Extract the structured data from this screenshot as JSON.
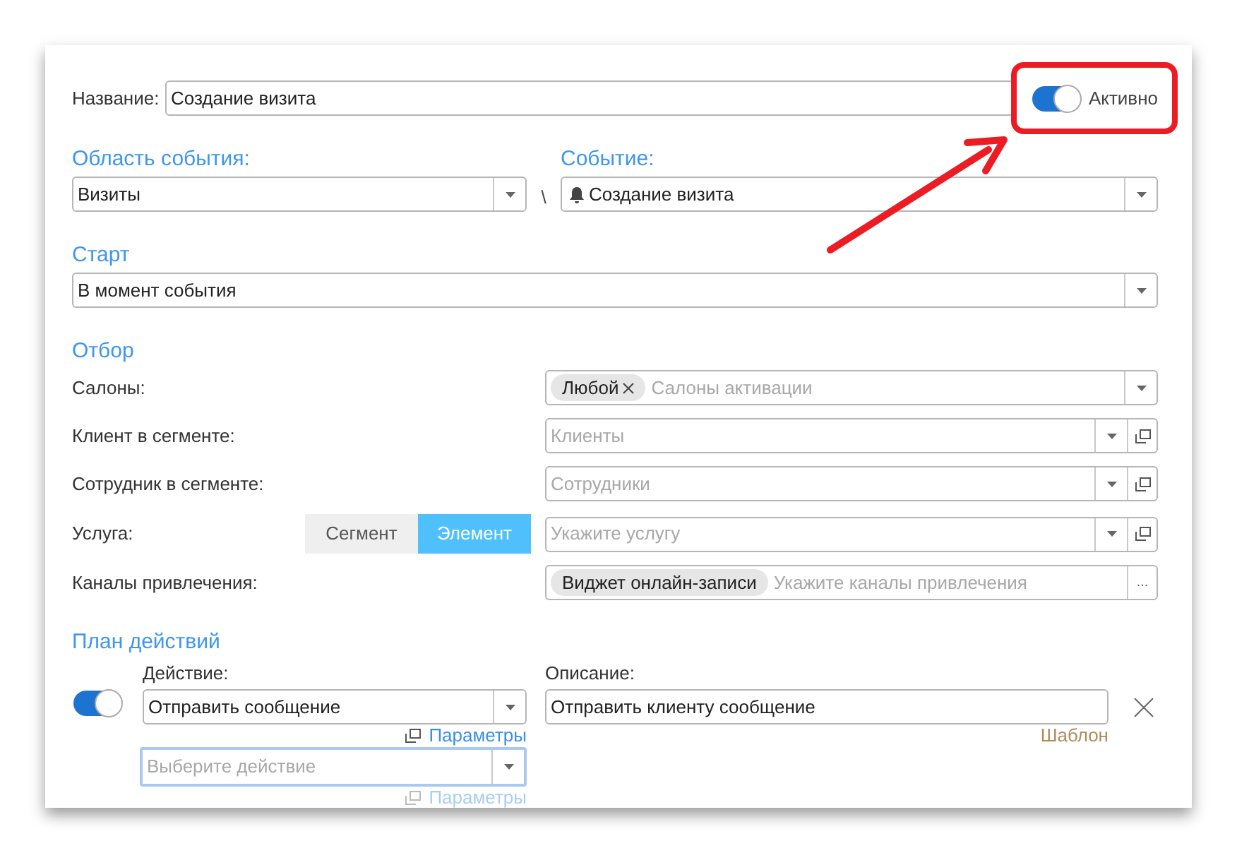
{
  "name_field": {
    "label": "Название:",
    "value": "Создание визита"
  },
  "active_toggle": {
    "label": "Активно",
    "on": true
  },
  "event_area": {
    "label": "Область события:",
    "value": "Визиты"
  },
  "separator": "\\",
  "event": {
    "label": "Событие:",
    "value": "Создание визита"
  },
  "start": {
    "label": "Старт",
    "value": "В момент события"
  },
  "filter": {
    "title": "Отбор",
    "rows": [
      {
        "label": "Салоны:",
        "tags": [
          {
            "label": "Любой",
            "removable": true
          }
        ],
        "placeholder": "Салоны активации",
        "buttons": [
          {
            "kind": "dropdown"
          }
        ]
      },
      {
        "label": "Клиент в сегменте:",
        "placeholder": "Клиенты",
        "buttons": [
          {
            "kind": "dropdown"
          },
          {
            "kind": "open"
          }
        ]
      },
      {
        "label": "Сотрудник в сегменте:",
        "placeholder": "Сотрудники",
        "buttons": [
          {
            "kind": "dropdown"
          },
          {
            "kind": "open"
          }
        ]
      },
      {
        "label": "Услуга:",
        "segments": [
          {
            "label": "Сегмент",
            "selected": false
          },
          {
            "label": "Элемент",
            "selected": true
          }
        ],
        "placeholder": "Укажите услугу",
        "buttons": [
          {
            "kind": "dropdown"
          },
          {
            "kind": "open"
          }
        ]
      },
      {
        "label": "Каналы привлечения:",
        "tags": [
          {
            "label": "Виджет онлайн-записи",
            "removable": false
          }
        ],
        "placeholder": "Укажите каналы привлечения",
        "buttons": [
          {
            "kind": "text",
            "label": "..."
          }
        ]
      }
    ]
  },
  "plan": {
    "title": "План действий",
    "action_label": "Действие:",
    "description_label": "Описание:",
    "actions": [
      {
        "on": true,
        "value": "Отправить сообщение",
        "params_link": "Параметры",
        "description": "Отправить клиенту сообщение",
        "template_link": "Шаблон"
      }
    ],
    "new_action": {
      "placeholder": "Выберите действие",
      "focused": true,
      "params_link": "Параметры",
      "disabled": true
    }
  }
}
